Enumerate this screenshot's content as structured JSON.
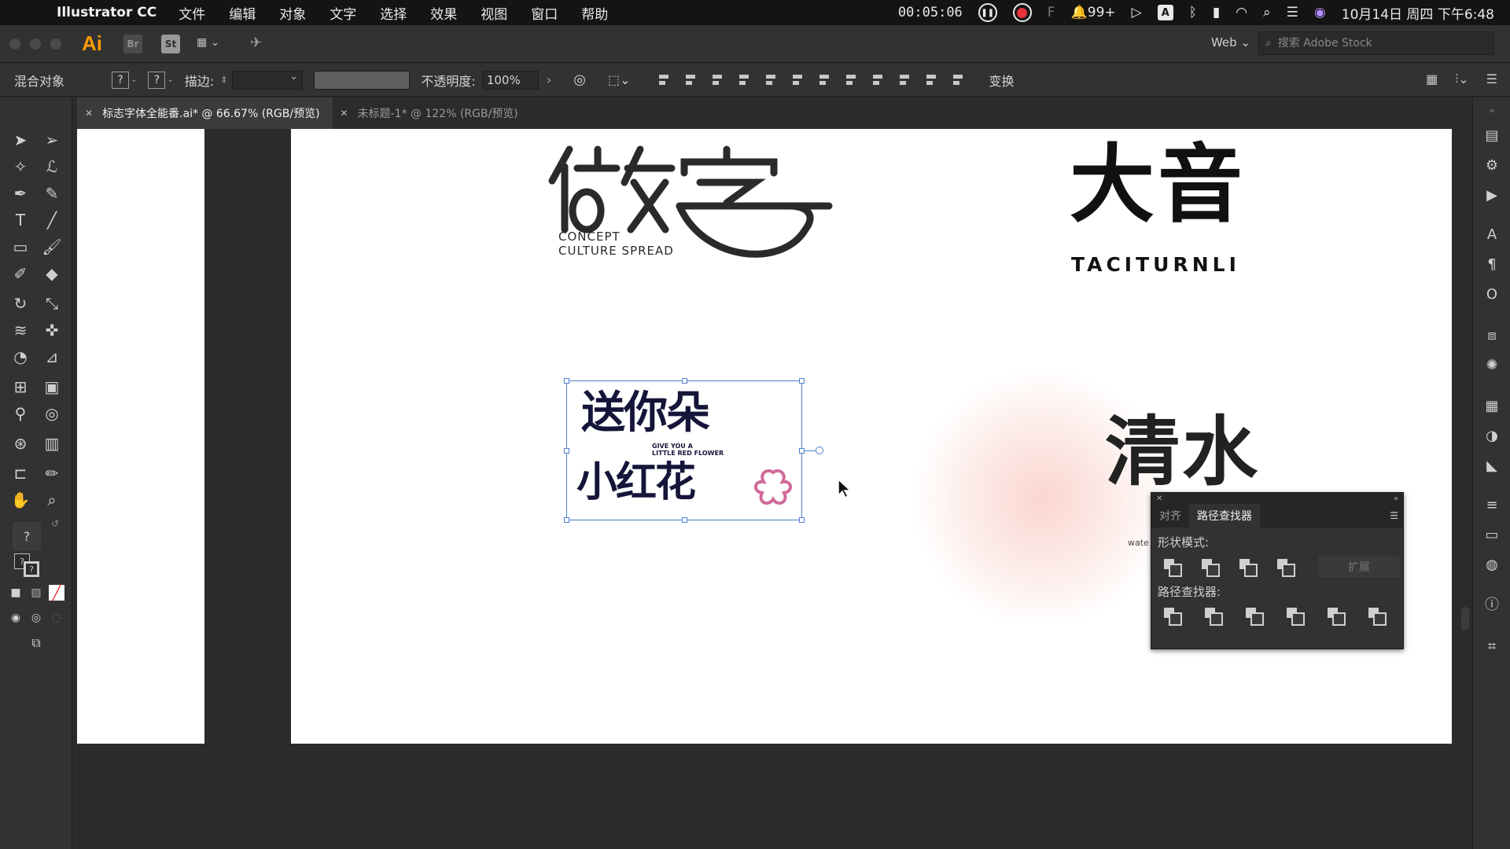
{
  "menubar": {
    "app_name": "Illustrator CC",
    "items": [
      "文件",
      "编辑",
      "对象",
      "文字",
      "选择",
      "效果",
      "视图",
      "窗口",
      "帮助"
    ],
    "record_timer": "00:05:06",
    "notifications": "99+",
    "input_method": "A",
    "clock": "10月14日 周四 下午6:48"
  },
  "header": {
    "logo": "Ai",
    "bridge": "Br",
    "stock": "St",
    "workspace": "Web",
    "search_placeholder": "搜索 Adobe Stock"
  },
  "control_bar": {
    "selection_type": "混合对象",
    "stroke_label": "描边:",
    "opacity_label": "不透明度:",
    "opacity_value": "100%",
    "transform_label": "变换"
  },
  "tabs": [
    {
      "label": "标志字体全能番.ai* @ 66.67% (RGB/预览)"
    },
    {
      "label": "未标题-1* @ 122% (RGB/预览)"
    }
  ],
  "artwork": {
    "logo1_line1": "CONCEPT",
    "logo1_line2": "CULTURE SPREAD",
    "logo2_cn": "大音",
    "logo2_en": "TACITURNLI",
    "logo3_line1": "送你朵",
    "logo3_line2": "小红花",
    "logo3_en1": "GIVE YOU A",
    "logo3_en2": "LITTLE RED FLOWER",
    "logo4_cn": "清水",
    "logo4_en": "wate"
  },
  "pathfinder_panel": {
    "tab_align": "对齐",
    "tab_pathfinder": "路径查找器",
    "shape_modes_label": "形状模式:",
    "pathfinders_label": "路径查找器:",
    "expand_label": "扩展"
  },
  "colors": {
    "accent": "#ff9a00",
    "selection": "#4d7fcc",
    "record": "#e8313a",
    "logo3_ink": "#15153a",
    "flower_pink": "#d06a9a"
  }
}
